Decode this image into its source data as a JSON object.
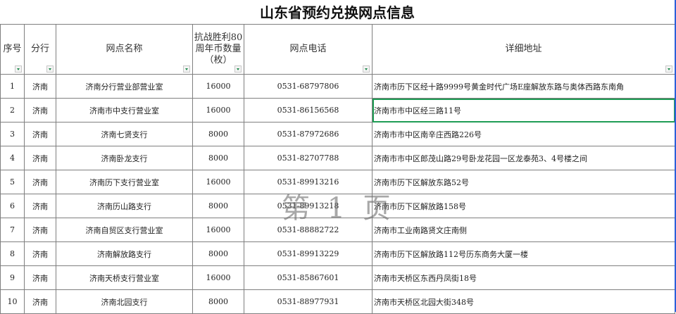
{
  "title": "山东省预约兑换网点信息",
  "headers": [
    "序号",
    "分行",
    "网点名称",
    "抗战胜利80周年币数量（枚）",
    "网点电话",
    "详细地址"
  ],
  "rows": [
    [
      "1",
      "济南",
      "济南分行营业部营业室",
      "16000",
      "0531-68797806",
      "济南市历下区经十路9999号黄金时代广场E座解放东路与奥体西路东南角"
    ],
    [
      "2",
      "济南",
      "济南市中支行营业室",
      "16000",
      "0531-86156568",
      "济南市市中区经三路11号"
    ],
    [
      "3",
      "济南",
      "济南七贤支行",
      "8000",
      "0531-87972686",
      "济南市市中区南辛庄西路226号"
    ],
    [
      "4",
      "济南",
      "济南卧龙支行",
      "8000",
      "0531-82707788",
      "济南市市中区郎茂山路29号卧龙花园一区龙泰苑3、4号楼之间"
    ],
    [
      "5",
      "济南",
      "济南历下支行营业室",
      "16000",
      "0531-89913216",
      "济南市历下区解放东路52号"
    ],
    [
      "6",
      "济南",
      "济南历山路支行",
      "8000",
      "0531-89913218",
      "济南市历下区解放路158号"
    ],
    [
      "7",
      "济南",
      "济南自贸区支行营业室",
      "16000",
      "0531-88882722",
      "济南市工业南路贤文庄南侧"
    ],
    [
      "8",
      "济南",
      "济南解放路支行",
      "8000",
      "0531-89913229",
      "济南市历下区解放路112号历东商务大厦一楼"
    ],
    [
      "9",
      "济南",
      "济南天桥支行营业室",
      "16000",
      "0531-85867601",
      "济南市天桥区东西丹凤街18号"
    ],
    [
      "10",
      "济南",
      "济南北园支行",
      "8000",
      "0531-88977931",
      "济南市天桥区北园大街348号"
    ]
  ],
  "watermark": "第 1 页"
}
